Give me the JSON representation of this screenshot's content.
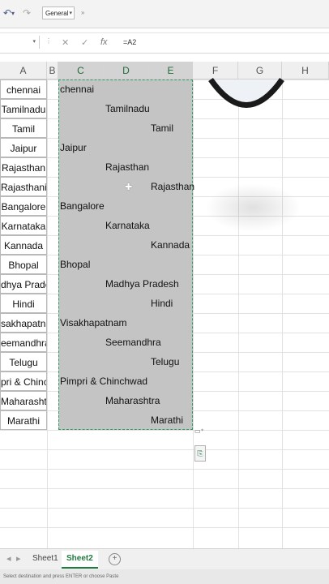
{
  "toolbar": {
    "number_format": "General",
    "undo_icon": "undo-icon",
    "redo_icon": "redo-icon"
  },
  "formula_bar": {
    "name_box": "",
    "formula": "=A2",
    "cancel_icon": "close-icon",
    "enter_icon": "check-icon",
    "fx_icon": "fx-icon"
  },
  "columns": [
    "A",
    "B",
    "C",
    "D",
    "E",
    "F",
    "G",
    "H"
  ],
  "col_a_values": [
    "chennai",
    "Tamilnadu",
    "Tamil",
    "Jaipur",
    "Rajasthan",
    "Rajasthani",
    "Bangalore",
    "Karnataka",
    "Kannada",
    "Bhopal",
    "Madhya Pradesh",
    "Hindi",
    "Visakhapatnam",
    "Seemandhra",
    "Telugu",
    "Pimpri & Chinchwad",
    "Maharashtra",
    "Marathi"
  ],
  "col_a_display": [
    "chennai",
    "Tamilnadu",
    "Tamil",
    "Jaipur",
    "Rajasthan",
    "Rajasthani",
    "Bangalore",
    "Karnataka",
    "Kannada",
    "Bhopal",
    "dhya Pradesh",
    "Hindi",
    "sakhapatnam",
    "eemandhra",
    "Telugu",
    "pri & Chinchwa",
    "Maharashtra",
    "Marathi"
  ],
  "selection_cells": [
    {
      "col": "C",
      "value": "chennai"
    },
    {
      "col": "D",
      "value": "Tamilnadu"
    },
    {
      "col": "E",
      "value": "Tamil"
    },
    {
      "col": "C",
      "value": "Jaipur"
    },
    {
      "col": "D",
      "value": "Rajasthan"
    },
    {
      "col": "E",
      "value": "Rajasthan"
    },
    {
      "col": "C",
      "value": "Bangalore"
    },
    {
      "col": "D",
      "value": "Karnataka"
    },
    {
      "col": "E",
      "value": "Kannada"
    },
    {
      "col": "C",
      "value": "Bhopal"
    },
    {
      "col": "D",
      "value": "Madhya Pradesh"
    },
    {
      "col": "E",
      "value": "Hindi"
    },
    {
      "col": "C",
      "value": "Visakhapatnam"
    },
    {
      "col": "D",
      "value": "Seemandhra"
    },
    {
      "col": "E",
      "value": "Telugu"
    },
    {
      "col": "C",
      "value": "Pimpri & Chinchwad"
    },
    {
      "col": "D",
      "value": "Maharashtra"
    },
    {
      "col": "E",
      "value": "Marathi"
    }
  ],
  "sheets": [
    "Sheet1",
    "Sheet2"
  ],
  "active_sheet": "Sheet2",
  "status": "Select destination and press ENTER or choose Paste",
  "colors": {
    "selection_fill": "#c4c4c4",
    "selection_border": "#2e9c63",
    "active_tab": "#1f7a3f"
  }
}
